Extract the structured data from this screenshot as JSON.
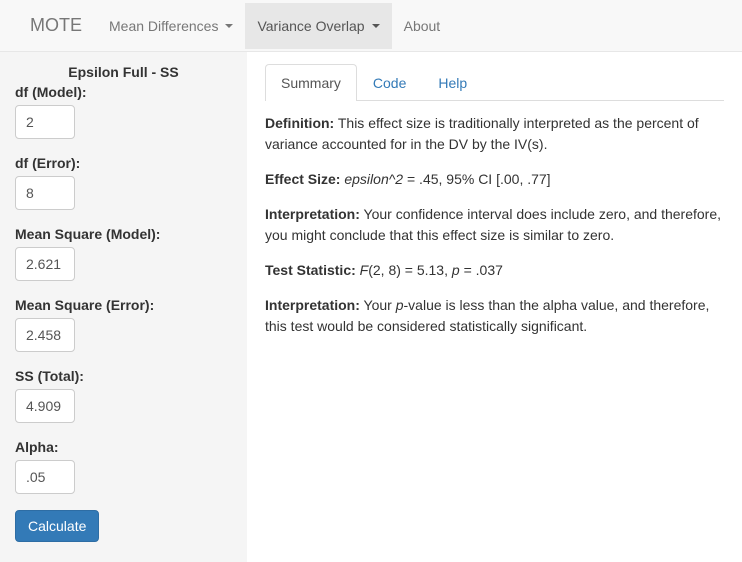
{
  "navbar": {
    "brand": "MOTE",
    "items": [
      {
        "label": "Mean Differences",
        "dropdown": true,
        "active": false
      },
      {
        "label": "Variance Overlap",
        "dropdown": true,
        "active": true
      },
      {
        "label": "About",
        "dropdown": false,
        "active": false
      }
    ]
  },
  "sidebar": {
    "title": "Epsilon Full - SS",
    "fields": {
      "df_model": {
        "label": "df (Model):",
        "value": "2"
      },
      "df_error": {
        "label": "df (Error):",
        "value": "8"
      },
      "ms_model": {
        "label": "Mean Square (Model):",
        "value": "2.621"
      },
      "ms_error": {
        "label": "Mean Square (Error):",
        "value": "2.458"
      },
      "ss_total": {
        "label": "SS (Total):",
        "value": "4.909"
      },
      "alpha": {
        "label": "Alpha:",
        "value": ".05"
      }
    },
    "calculate_label": "Calculate"
  },
  "tabs": {
    "summary": "Summary",
    "code": "Code",
    "help": "Help"
  },
  "summary": {
    "definition_label": "Definition:",
    "definition_text": " This effect size is traditionally interpreted as the percent of variance accounted for in the DV by the IV(s).",
    "effectsize_label": "Effect Size:",
    "effectsize_stat": "epsilon^2",
    "effectsize_rest": " = .45, 95% CI [.00, .77]",
    "interp1_label": "Interpretation:",
    "interp1_text": " Your confidence interval does include zero, and therefore, you might conclude that this effect size is similar to zero.",
    "teststat_label": "Test Statistic:",
    "teststat_F": "F",
    "teststat_mid": "(2, 8) = 5.13, ",
    "teststat_p": "p",
    "teststat_rest": " = .037",
    "interp2_label": "Interpretation:",
    "interp2_pre": " Your ",
    "interp2_p": "p",
    "interp2_post": "-value is less than the alpha value, and therefore, this test would be considered statistically significant."
  }
}
